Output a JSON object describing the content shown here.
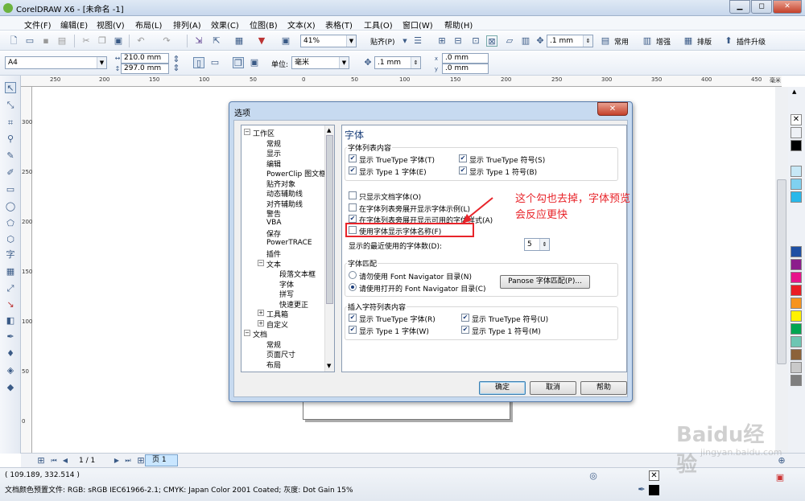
{
  "titlebar": {
    "title": "CorelDRAW X6 - [未命名 -1]",
    "min": "▁",
    "max": "◻",
    "close": "✕"
  },
  "menu": [
    "文件(F)",
    "编辑(E)",
    "视图(V)",
    "布局(L)",
    "排列(A)",
    "效果(C)",
    "位图(B)",
    "文本(X)",
    "表格(T)",
    "工具(O)",
    "窗口(W)",
    "帮助(H)"
  ],
  "toolbar1": {
    "zoom": "41%",
    "snap": "贴齐(P)",
    "nudge": ".1 mm",
    "common": "常用",
    "enhance": "增强",
    "layout": "排版",
    "upgrade": "插件升级"
  },
  "toolbar2": {
    "paper": "A4",
    "width": "210.0 mm",
    "height": "297.0 mm",
    "units_label": "单位:",
    "units": "毫米",
    "nudge": ".1 mm",
    "dup_x": ".0 mm",
    "dup_y": ".0 mm"
  },
  "hruler": [
    "250",
    "200",
    "150",
    "100",
    "50",
    "0",
    "50",
    "100",
    "150",
    "200",
    "250",
    "300",
    "350",
    "400",
    "450"
  ],
  "hruler_unit": "毫米",
  "vruler": [
    "300",
    "250",
    "200",
    "150",
    "100",
    "50",
    "0"
  ],
  "palette_colors": [
    "#ffffff",
    "#000000",
    "#c7e8f6",
    "#28b8ea",
    "#1d4fa3",
    "#8c1d8c",
    "#e7158a",
    "#ea1c24",
    "#f7941d",
    "#fff200",
    "#00a651",
    "#6dc6b3",
    "#8c6239",
    "#c9c9c9",
    "#7f7f7f"
  ],
  "pagebar": {
    "counter": "1 / 1",
    "tab": "页 1"
  },
  "status": {
    "coords": "( 109.189, 332.514 )",
    "profile": "文档颜色预置文件: RGB: sRGB IEC61966-2.1; CMYK: Japan Color 2001 Coated; 灰度: Dot Gain 15%"
  },
  "dialog": {
    "title": "选项",
    "close": "✕",
    "tree": [
      {
        "label": "工作区",
        "level": 0,
        "exp": "−"
      },
      {
        "label": "常规",
        "level": 1
      },
      {
        "label": "显示",
        "level": 1
      },
      {
        "label": "编辑",
        "level": 1
      },
      {
        "label": "PowerClip 图文框",
        "level": 1
      },
      {
        "label": "贴齐对象",
        "level": 1
      },
      {
        "label": "动态辅助线",
        "level": 1
      },
      {
        "label": "对齐辅助线",
        "level": 1
      },
      {
        "label": "警告",
        "level": 1
      },
      {
        "label": "VBA",
        "level": 1
      },
      {
        "label": "保存",
        "level": 1
      },
      {
        "label": "PowerTRACE",
        "level": 1
      },
      {
        "label": "插件",
        "level": 1
      },
      {
        "label": "文本",
        "level": 1,
        "exp": "−"
      },
      {
        "label": "段落文本框",
        "level": 2
      },
      {
        "label": "字体",
        "level": 2
      },
      {
        "label": "拼写",
        "level": 2
      },
      {
        "label": "快速更正",
        "level": 2
      },
      {
        "label": "工具箱",
        "level": 1,
        "exp": "+"
      },
      {
        "label": "自定义",
        "level": 1,
        "exp": "+"
      },
      {
        "label": "文档",
        "level": 0,
        "exp": "−"
      },
      {
        "label": "常规",
        "level": 1
      },
      {
        "label": "页面尺寸",
        "level": 1
      },
      {
        "label": "布局",
        "level": 1
      }
    ],
    "panel_title": "字体",
    "group1": {
      "label": "字体列表内容",
      "items": [
        "显示 TrueType 字体(T)",
        "显示 TrueType 符号(S)",
        "显示 Type 1 字体(E)",
        "显示 Type 1 符号(B)"
      ]
    },
    "opts": [
      {
        "label": "只显示文档字体(O)",
        "checked": false
      },
      {
        "label": "在字体列表旁展开显示字体示例(L)",
        "checked": false
      },
      {
        "label": "在字体列表旁展开显示可用的字体样式(A)",
        "checked": true
      },
      {
        "label": "使用字体显示字体名称(F)",
        "checked": false
      }
    ],
    "recent_label": "显示的最近使用的字体数(D):",
    "recent_value": "5",
    "group2": {
      "label": "字体匹配",
      "r1": "请勿使用 Font Navigator 目录(N)",
      "r2": "请使用打开的 Font Navigator 目录(C)",
      "button": "Panose 字体匹配(P)..."
    },
    "group3": {
      "label": "插入字符列表内容",
      "items": [
        "显示 TrueType 字体(R)",
        "显示 TrueType 符号(U)",
        "显示 Type 1 字体(W)",
        "显示 Type 1 符号(M)"
      ]
    },
    "ok": "确定",
    "cancel": "取消",
    "help": "帮助"
  },
  "annotation": {
    "line1": "这个勾也去掉，字体预览",
    "line2": "会反应更快",
    "color": "#e8242a"
  },
  "watermark": {
    "brand": "Baidu经验",
    "url": "jingyan.baidu.com"
  }
}
